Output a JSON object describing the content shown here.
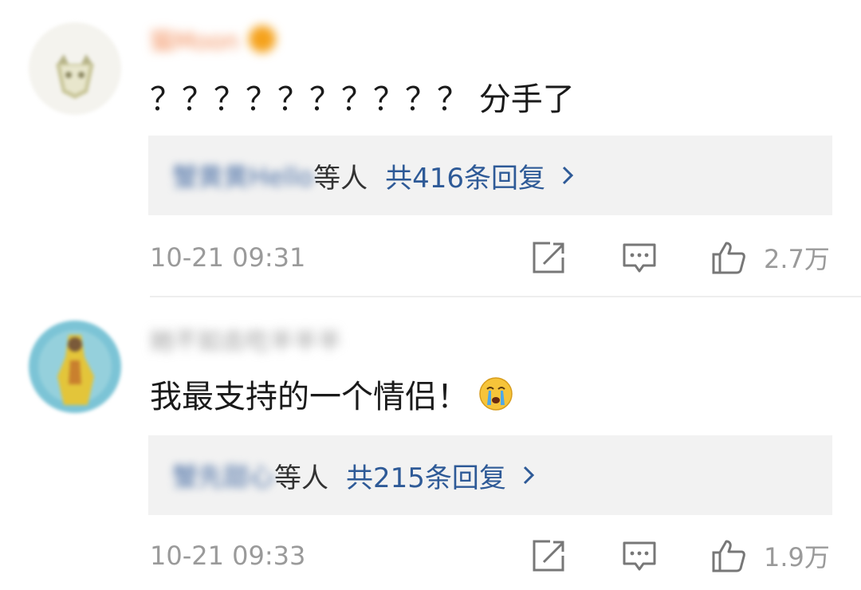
{
  "comments": [
    {
      "username": "猫Moon",
      "text": "？？？？？？？？？？ 分手了",
      "reply": {
        "names": "蟹黄黄Hello",
        "suffix": "等人",
        "count_label": "共416条回复"
      },
      "time": "10-21 09:31",
      "likes": "2.7万"
    },
    {
      "username": "她不如去吃半半半",
      "text": "我最支持的一个情侣！",
      "emoji": "crying-face-icon",
      "reply": {
        "names": "蟹先甜心",
        "suffix": "等人",
        "count_label": "共215条回复"
      },
      "time": "10-21 09:33",
      "likes": "1.9万"
    }
  ],
  "colors": {
    "link": "#2e5a97",
    "meta_gray": "#9a9a9a",
    "reply_bg": "#f2f2f2",
    "username_orange": "#f28c58"
  }
}
